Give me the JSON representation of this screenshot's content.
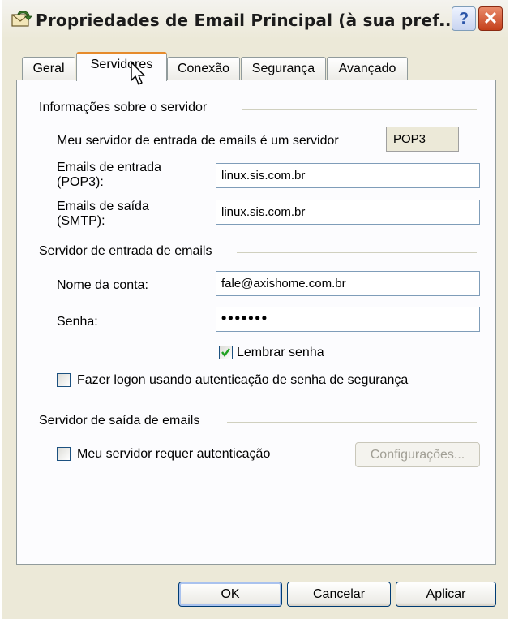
{
  "window": {
    "title": "Propriedades de Email Principal  (à sua pref...",
    "help_label": "?",
    "close_label": "✕"
  },
  "tabs": [
    {
      "label": "Geral"
    },
    {
      "label": "Servidores",
      "active": true
    },
    {
      "label": "Conexão"
    },
    {
      "label": "Segurança"
    },
    {
      "label": "Avançado"
    }
  ],
  "server_info": {
    "group_label": "Informações sobre o servidor",
    "incoming_type_label": "Meu servidor de entrada de emails é um  servidor",
    "incoming_type_value": "POP3",
    "incoming_label_line1": "Emails de entrada",
    "incoming_label_line2": "(POP3):",
    "incoming_value": "linux.sis.com.br",
    "outgoing_label_line1": "Emails de saída",
    "outgoing_label_line2": "(SMTP):",
    "outgoing_value": "linux.sis.com.br"
  },
  "incoming_server": {
    "group_label": "Servidor de entrada de emails",
    "account_label": "Nome da conta:",
    "account_value": "fale@axishome.com.br",
    "password_label": "Senha:",
    "password_value": "•••••••",
    "remember_label": "Lembrar senha",
    "remember_checked": true,
    "spa_label": "Fazer logon usando autenticação de senha de segurança",
    "spa_checked": false
  },
  "outgoing_server": {
    "group_label": "Servidor de saída de emails",
    "auth_label": "Meu servidor requer autenticação",
    "auth_checked": false,
    "settings_button": "Configurações..."
  },
  "buttons": {
    "ok": "OK",
    "cancel": "Cancelar",
    "apply": "Aplicar"
  },
  "colors": {
    "xp_face": "#ece9d8",
    "tab_highlight": "#e68b2c",
    "close_red": "#c4401b",
    "input_border": "#7f9db9"
  }
}
